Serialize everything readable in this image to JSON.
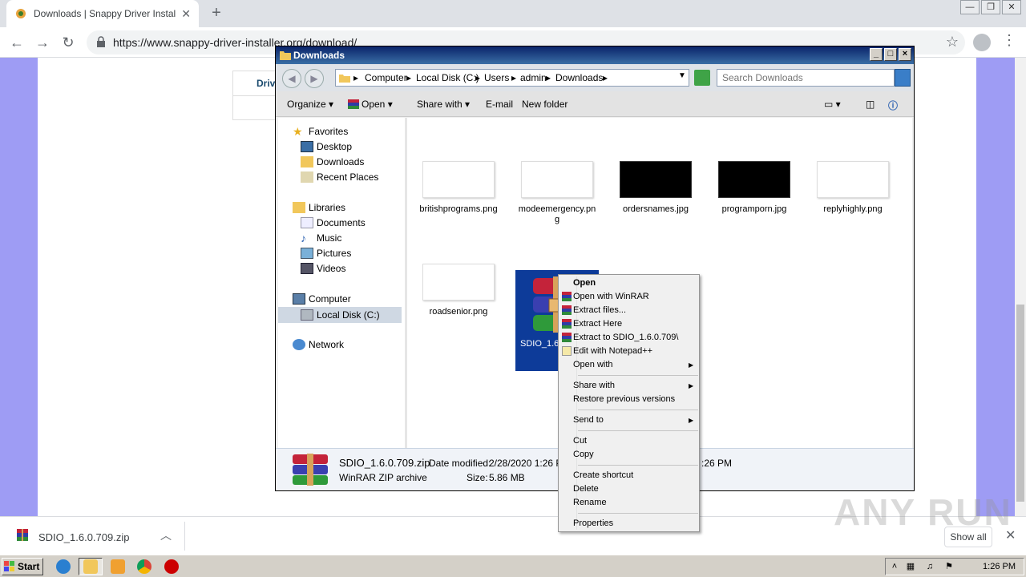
{
  "browser": {
    "tab_title": "Downloads | Snappy Driver Installer",
    "new_tab": "+",
    "url": "https://www.snappy-driver-installer.org/download/",
    "window_controls": [
      "—",
      "❐",
      "✕"
    ]
  },
  "site": {
    "partial_text": "Driv"
  },
  "explorer": {
    "title": "Downloads",
    "breadcrumbs": [
      "Computer",
      "Local Disk (C:)",
      "Users",
      "admin",
      "Downloads"
    ],
    "search_placeholder": "Search Downloads",
    "commands": {
      "organize": "Organize",
      "open": "Open",
      "share_with": "Share with",
      "email": "E-mail",
      "new_folder": "New folder"
    },
    "nav": {
      "favorites": "Favorites",
      "desktop": "Desktop",
      "downloads": "Downloads",
      "recent": "Recent Places",
      "libraries": "Libraries",
      "documents": "Documents",
      "music": "Music",
      "pictures": "Pictures",
      "videos": "Videos",
      "computer": "Computer",
      "local_disk": "Local Disk (C:)",
      "network": "Network"
    },
    "files": [
      {
        "name": "britishprograms.png",
        "thumb": "white"
      },
      {
        "name": "modeemergency.png",
        "thumb": "white"
      },
      {
        "name": "ordersnames.jpg",
        "thumb": "black"
      },
      {
        "name": "programporn.jpg",
        "thumb": "black"
      },
      {
        "name": "replyhighly.png",
        "thumb": "white"
      },
      {
        "name": "roadsenior.png",
        "thumb": "white"
      },
      {
        "name": "SDIO_1.6",
        "thumb": "winrar"
      }
    ],
    "details": {
      "filename": "SDIO_1.6.0.709.zip",
      "type": "WinRAR ZIP archive",
      "modified_label": "Date modified:",
      "modified_value": "2/28/2020 1:26 PM",
      "size_label": "Size:",
      "size_value": "5.86 MB",
      "created_tail": ":26 PM"
    }
  },
  "context_menu": {
    "open": "Open",
    "open_winrar": "Open with WinRAR",
    "extract_files": "Extract files...",
    "extract_here": "Extract Here",
    "extract_to": "Extract to SDIO_1.6.0.709\\",
    "edit_notepad": "Edit with Notepad++",
    "open_with": "Open with",
    "share_with": "Share with",
    "restore": "Restore previous versions",
    "send_to": "Send to",
    "cut": "Cut",
    "copy": "Copy",
    "create_shortcut": "Create shortcut",
    "delete": "Delete",
    "rename": "Rename",
    "properties": "Properties"
  },
  "shelf": {
    "filename": "SDIO_1.6.0.709.zip",
    "show_all": "Show all"
  },
  "watermark": "ANY RUN",
  "taskbar": {
    "start": "Start",
    "clock": "1:26 PM"
  }
}
